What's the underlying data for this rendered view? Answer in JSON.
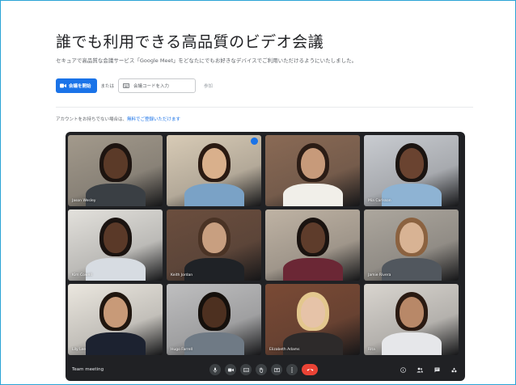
{
  "hero": {
    "title": "誰でも利用できる高品質のビデオ会議",
    "subtitle": "セキュアで高品質な会議サービス「Google Meet」をどなたにでもお好きなデバイスでご利用いただけるようにいたしました。"
  },
  "actions": {
    "new_meeting_label": "会議を開始",
    "or_label": "または",
    "code_placeholder": "会議コードを入力",
    "join_label": "参加"
  },
  "account_note": {
    "text": "アカウントをお持ちでない場合は、",
    "link": "無料でご登録いただけます"
  },
  "meeting": {
    "name": "Team meeting",
    "participants": [
      {
        "name": "Jason Wesley",
        "skin": "#5b3a28",
        "hair": "#1d1410",
        "shirt": "#3a3f44",
        "bg": "#a39a8c"
      },
      {
        "name": "",
        "skin": "#d9b08c",
        "hair": "#2a1a12",
        "shirt": "#7aa2c6",
        "bg": "#d8cbb6",
        "pinned": true
      },
      {
        "name": "",
        "skin": "#c79a7a",
        "hair": "#2b1c15",
        "shirt": "#f1efe9",
        "bg": "#8a6a55"
      },
      {
        "name": "Mia Carlsson",
        "skin": "#6a4330",
        "hair": "#1b1411",
        "shirt": "#8eb3d3",
        "bg": "#c9ccd1"
      },
      {
        "name": "Kim Cowell",
        "skin": "#5a3928",
        "hair": "#1a1310",
        "shirt": "#d7dce2",
        "bg": "#e3e1dc"
      },
      {
        "name": "Keith Jordan",
        "skin": "#c89f80",
        "hair": "#4a3325",
        "shirt": "#1f2226",
        "bg": "#6b4e3e"
      },
      {
        "name": "",
        "skin": "#5e3c2b",
        "hair": "#1a1310",
        "shirt": "#6b2735",
        "bg": "#bfb3a4"
      },
      {
        "name": "Jamie Rivera",
        "skin": "#d8b394",
        "hair": "#8b6240",
        "shirt": "#51575e",
        "bg": "#ada79e"
      },
      {
        "name": "Lily Lee",
        "skin": "#c89a78",
        "hair": "#20160f",
        "shirt": "#1c2230",
        "bg": "#ebe7df"
      },
      {
        "name": "Hugo Farrell",
        "skin": "#4d3020",
        "hair": "#15100c",
        "shirt": "#6f7a85",
        "bg": "#bfbfc0"
      },
      {
        "name": "Elizabeth Adams",
        "skin": "#e6c3a8",
        "hair": "#e3c78e",
        "shirt": "#2d2a2a",
        "bg": "#7a4a35"
      },
      {
        "name": "Rita",
        "skin": "#b88868",
        "hair": "#2a1a12",
        "shirt": "#e6e7ea",
        "bg": "#d9d5cf"
      }
    ]
  },
  "icons": {
    "video": "video-icon",
    "keyboard": "keyboard-icon",
    "mic": "mic-icon",
    "camera": "camera-icon",
    "captions": "captions-icon",
    "hand": "raise-hand-icon",
    "present": "present-icon",
    "more": "more-icon",
    "end": "end-call-icon",
    "info": "info-icon",
    "people": "people-icon",
    "chat": "chat-icon",
    "activities": "activities-icon"
  },
  "colors": {
    "accent": "#1a73e8",
    "end_call": "#ea4335",
    "meet_bg": "#202124"
  }
}
